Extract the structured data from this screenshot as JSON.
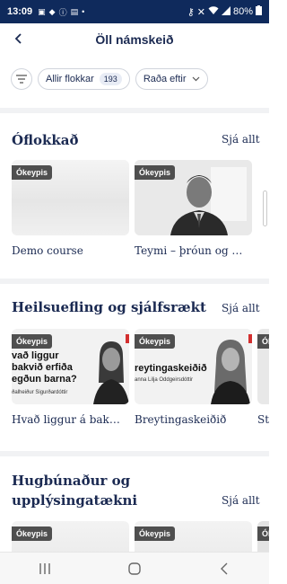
{
  "status_bar": {
    "time": "13:09",
    "battery": "80%",
    "icons_left": [
      "photo-icon",
      "android-icon",
      "info-icon",
      "calendar-icon",
      "dot-icon"
    ],
    "icons_right": [
      "key-icon",
      "mute-icon",
      "wifi-icon",
      "signal-icon",
      "battery-icon"
    ]
  },
  "appbar": {
    "title": "Öll námskeið",
    "back_icon": "back-arrow-icon"
  },
  "filters": {
    "category_label": "Allir flokkar",
    "category_count": "193",
    "sort_label": "Raða eftir"
  },
  "sections": [
    {
      "title": "Óflokkað",
      "see_all": "Sjá allt",
      "courses": [
        {
          "badge": "Ókeypis",
          "title": "Demo course"
        },
        {
          "badge": "Ókeypis",
          "title": "Teymi – þróun og …"
        }
      ]
    },
    {
      "title": "Heilsuefling og sjálfsrækt",
      "see_all": "Sjá allt",
      "courses": [
        {
          "badge": "Ókeypis",
          "title": "Hvað liggur á bak…",
          "thumb_text": [
            "vað liggur",
            "bakvið erfiða",
            "egðun barna?"
          ],
          "thumb_author": "ðalheiður Sigurðardóttir"
        },
        {
          "badge": "Ókeypis",
          "title": "Breytingaskeiðið",
          "thumb_text": [
            "reytingaskeiðið"
          ],
          "thumb_author": "anna Lilja Oddgeirsdóttir"
        },
        {
          "badge": "Ók",
          "title": "St"
        }
      ]
    },
    {
      "title": "Hugbúnaður og upplýsingatækni",
      "see_all": "Sjá allt",
      "courses": [
        {
          "badge": "Ókeypis"
        },
        {
          "badge": "Ókeypis"
        },
        {
          "badge": "Ók"
        }
      ]
    }
  ],
  "nav_bar": {
    "recents_icon": "recents-icon",
    "home_icon": "home-icon",
    "back_icon": "nav-back-icon"
  },
  "colors": {
    "status_bar_bg": "#0f2a5c",
    "primary_text": "#1b2a52",
    "badge_bg": "#4f4f4f",
    "divider": "#f1f2f4"
  }
}
